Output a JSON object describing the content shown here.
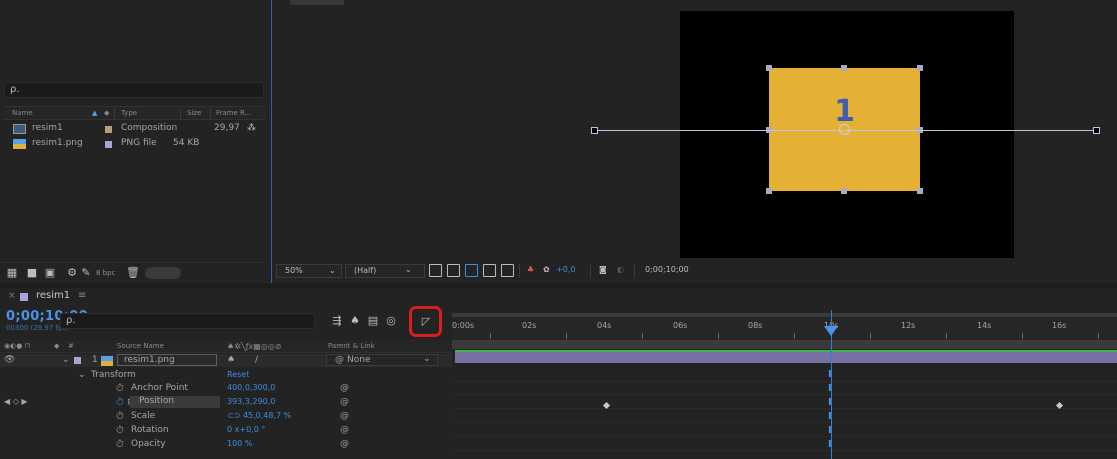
{
  "project": {
    "search_placeholder": "ρ.",
    "columns": {
      "name": "Name",
      "type": "Type",
      "size": "Size",
      "frame_rate": "Frame R..."
    },
    "items": [
      {
        "name": "resim1",
        "type": "Composition",
        "size": "",
        "frame_rate": "29,97",
        "icon": "composition-icon",
        "label_color": "#b5a27a"
      },
      {
        "name": "resim1.png",
        "type": "PNG file",
        "size": "54 KB",
        "frame_rate": "",
        "icon": "png-file-icon",
        "label_color": "#a7a6d8"
      }
    ],
    "footer": {
      "bpc": "8 bpc"
    }
  },
  "viewer": {
    "zoom": "50%",
    "resolution": "(Half)",
    "exposure": "+0,0",
    "timecode": "0;00;10;00",
    "solid_label": "1",
    "solid_color": "#e4b134"
  },
  "timeline": {
    "tab_label": "resim1",
    "tab_menu": "≡",
    "close_glyph": "×",
    "timecode": "0;00;10;00",
    "timecode_sub": "00300 (29.97 fps)",
    "search_placeholder": "ρ.",
    "columns": {
      "num": "#",
      "source_name": "Source Name",
      "parent": "Parent & Link"
    },
    "layer": {
      "number": "1",
      "name": "resim1.png",
      "parent": "None"
    },
    "transform": {
      "label": "Transform",
      "reset": "Reset"
    },
    "properties": [
      {
        "name": "Anchor Point",
        "value": "400,0,300,0"
      },
      {
        "name": "Position",
        "value": "393,3,290,0"
      },
      {
        "name": "Scale",
        "value": "⊂⊃ 45,0,48,7 %"
      },
      {
        "name": "Rotation",
        "value": "0 x+0,0 °"
      },
      {
        "name": "Opacity",
        "value": "100 %"
      }
    ],
    "ruler_labels": [
      "0:00s",
      "02s",
      "04s",
      "06s",
      "08s",
      "10s",
      "12s",
      "14s",
      "16s"
    ],
    "current_time_marker": "10s"
  },
  "colors": {
    "accent": "#4a95e6",
    "highlight": "#d81d1d",
    "layer_bar": "#7670a3"
  }
}
